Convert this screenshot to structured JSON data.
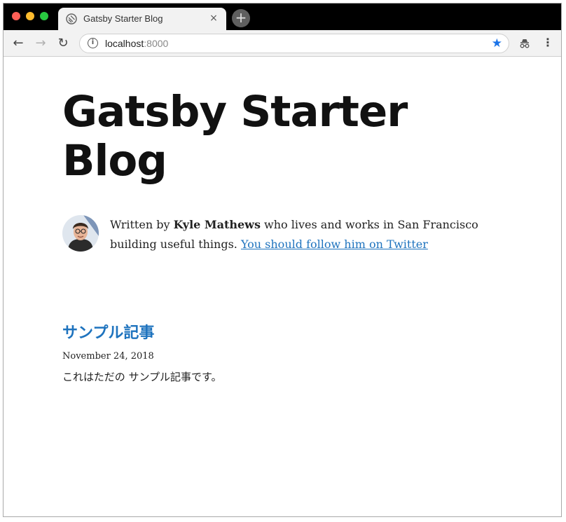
{
  "browser": {
    "tab": {
      "title": "Gatsby Starter Blog",
      "close": "×"
    },
    "new_tab": "+",
    "address": {
      "host": "localhost",
      "port": ":8000"
    },
    "nav": {
      "back": "←",
      "forward": "→",
      "reload": "↻"
    },
    "menu": "⋮",
    "accent": "#1a73e8"
  },
  "site": {
    "title": "Gatsby Starter Blog"
  },
  "bio": {
    "prefix": "Written by ",
    "author": "Kyle Mathews",
    "suffix": " who lives and works in San Francisco building useful things. ",
    "link_text": "You should follow him on Twitter"
  },
  "posts": [
    {
      "title": "サンプル記事",
      "date": "November 24, 2018",
      "excerpt": "これはただの サンプル記事です。"
    }
  ],
  "colors": {
    "link": "#1e73be",
    "text": "#222222",
    "heading": "#111111"
  }
}
